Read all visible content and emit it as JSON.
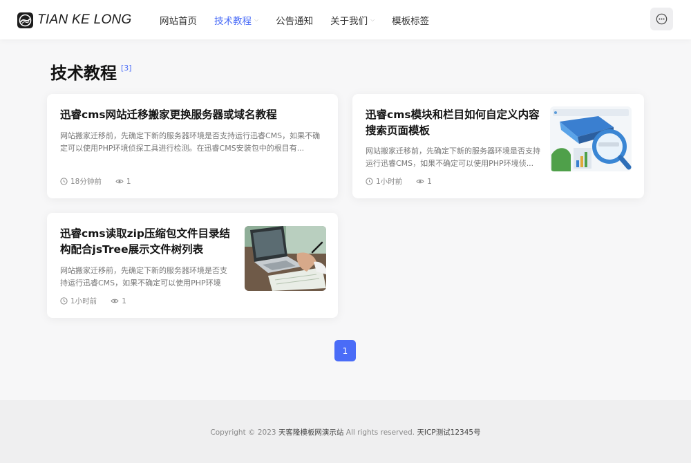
{
  "header": {
    "logo_text": "TIAN KE LONG",
    "nav": [
      {
        "label": "网站首页",
        "active": false,
        "has_dropdown": false
      },
      {
        "label": "技术教程",
        "active": true,
        "has_dropdown": true
      },
      {
        "label": "公告通知",
        "active": false,
        "has_dropdown": false
      },
      {
        "label": "关于我们",
        "active": false,
        "has_dropdown": true
      },
      {
        "label": "模板标签",
        "active": false,
        "has_dropdown": false
      }
    ],
    "menu_icon": "more-horizontal-icon"
  },
  "page": {
    "title": "技术教程",
    "count": "[3]"
  },
  "articles": [
    {
      "title": "迅睿cms网站迁移搬家更换服务器或域名教程",
      "desc": "网站搬家迁移前，先确定下新的服务器环境是否支持运行迅睿CMS，如果不确定可以使用PHP环境侦探工具进行检测。在迅睿CMS安装包中的根目有...",
      "time": "18分钟前",
      "views": "1",
      "has_thumb": false
    },
    {
      "title": "迅睿cms模块和栏目如何自定义内容搜索页面模板",
      "desc": "网站搬家迁移前，先确定下新的服务器环境是否支持运行迅睿CMS，如果不确定可以使用PHP环境侦...",
      "time": "1小时前",
      "views": "1",
      "has_thumb": true
    },
    {
      "title": "迅睿cms读取zip压缩包文件目录结构配合jsTree展示文件树列表",
      "desc": "网站搬家迁移前，先确定下新的服务器环境是否支持运行迅睿CMS，如果不确定可以使用PHP环境侦...",
      "time": "1小时前",
      "views": "1",
      "has_thumb": true
    }
  ],
  "pagination": {
    "current": "1"
  },
  "footer": {
    "copyright": "Copyright © 2023",
    "site_name": "天客隆模板网演示站",
    "rights": "All rights reserved.",
    "icp": "天ICP测试12345号"
  },
  "colors": {
    "accent": "#4a6cf7",
    "background": "#f7f7f8",
    "footer_bg": "#efeff0"
  }
}
